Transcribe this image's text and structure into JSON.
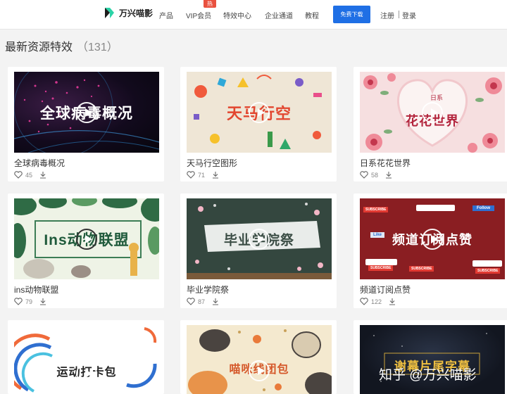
{
  "header": {
    "logo_text": "万兴喵影",
    "nav": [
      "产品",
      "VIP会员",
      "特效中心",
      "企业通道",
      "教程"
    ],
    "hot_badge": "热",
    "cta_label": "免费下载",
    "register_label": "注册",
    "login_label": "登录"
  },
  "section": {
    "title": "最新资源特效",
    "count": "（131）"
  },
  "cards": [
    {
      "name": "全球病毒概况",
      "thumb_title": "全球病毒概况",
      "likes": "45"
    },
    {
      "name": "天马行空图形",
      "thumb_title": "天马行空",
      "likes": "71"
    },
    {
      "name": "日系花花世界",
      "thumb_title": "花花世界",
      "thumb_subtitle": "日系",
      "likes": "58"
    },
    {
      "name": "ins动物联盟",
      "thumb_title": "Ins动物联盟",
      "likes": "79"
    },
    {
      "name": "毕业学院祭",
      "thumb_title": "毕业学院祭",
      "likes": "87"
    },
    {
      "name": "频道订阅点赞",
      "thumb_title": "频道订阅点赞",
      "likes": "122",
      "thumb_chips": [
        "SUBSCRIBE",
        "Follow",
        "Like",
        "SUBSCRIBE",
        "SUBSCRIBE",
        "SUBSCRIBE"
      ]
    },
    {
      "name": "",
      "thumb_title": "运动打卡包",
      "likes": ""
    },
    {
      "name": "",
      "thumb_title": "喵咪线团包",
      "likes": ""
    },
    {
      "name": "",
      "thumb_title": "谢幕片尾字幕",
      "likes": ""
    }
  ],
  "watermark": "知乎 @万兴喵影",
  "colors": {
    "brand_blue": "#1f6fe5",
    "hot_red": "#e9513f",
    "page_bg": "#f3f3f3"
  }
}
